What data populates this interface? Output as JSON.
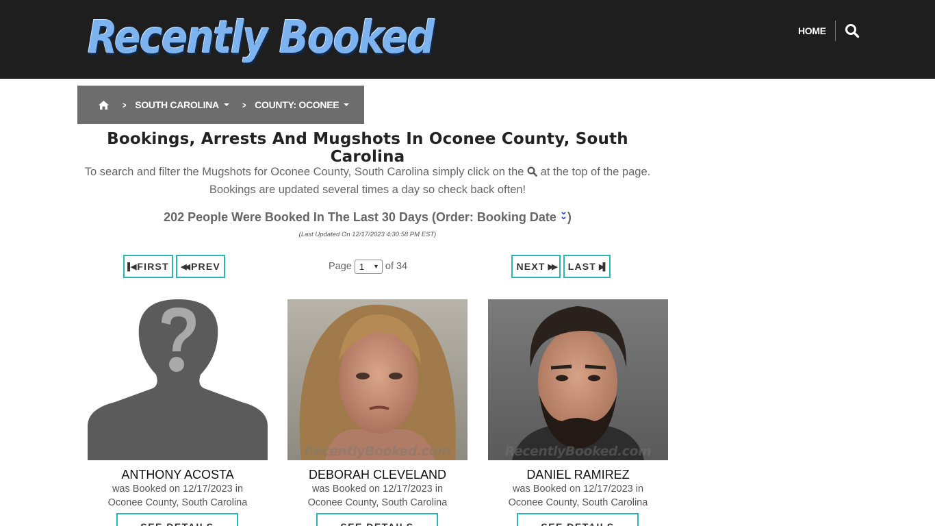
{
  "header": {
    "logo_text": "Recently Booked",
    "nav_home": "HOME",
    "search_icon": "search-icon"
  },
  "breadcrumb": {
    "home_icon": "home-icon",
    "items": [
      {
        "label": "SOUTH CAROLINA"
      },
      {
        "label": "COUNTY: OCONEE"
      }
    ]
  },
  "main": {
    "title": "Bookings, Arrests And Mugshots In Oconee County, South Carolina",
    "intro_before": "To search and filter the Mugshots for Oconee County, South Carolina simply click on the",
    "intro_after": "at the top of the page.",
    "intro_line2": "Bookings are updated several times a day so check back often!",
    "count_text": "202 People Were Booked In The Last 30 Days (Order: Booking Date",
    "count_close": ")",
    "updated": "(Last Updated On 12/17/2023 4:30:58 PM EST)"
  },
  "pagination": {
    "first": "FIRST",
    "prev": "PREV",
    "page_label": "Page",
    "page_value": "1",
    "of_text": "of 34",
    "next": "NEXT",
    "last": "LAST"
  },
  "cards": [
    {
      "name": "ANTHONY ACOSTA",
      "line1": "was Booked on 12/17/2023 in",
      "line2": "Oconee County, South Carolina",
      "button": "SEE DETAILS",
      "photo": "placeholder-silhouette"
    },
    {
      "name": "DEBORAH CLEVELAND",
      "line1": "was Booked on 12/17/2023 in",
      "line2": "Oconee County, South Carolina",
      "button": "SEE DETAILS",
      "photo": "mugshot",
      "watermark": "RecentlyBooked.com"
    },
    {
      "name": "DANIEL RAMIREZ",
      "line1": "was Booked on 12/17/2023 in",
      "line2": "Oconee County, South Carolina",
      "button": "SEE DETAILS",
      "photo": "mugshot",
      "watermark": "RecentlyBooked.com"
    }
  ],
  "colors": {
    "header_bg": "#1e1e1e",
    "breadcrumb_bg": "#6d6d6d",
    "button_border": "#2bb5b2",
    "logo_blue": "#7db4f0"
  }
}
